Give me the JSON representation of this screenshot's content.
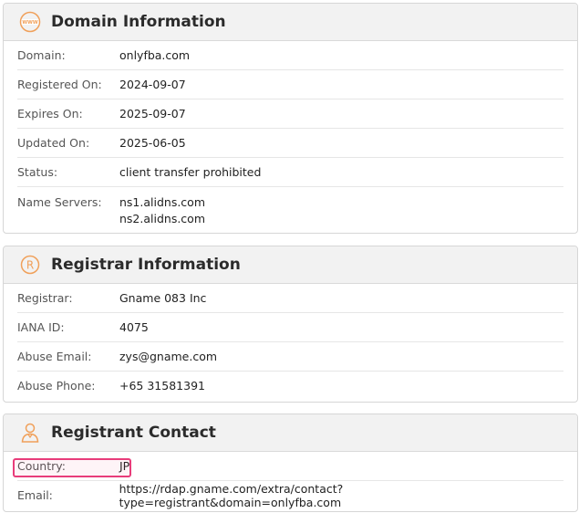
{
  "domain_info": {
    "title": "Domain Information",
    "icon": "www-icon",
    "rows": [
      {
        "label": "Domain:",
        "value": "onlyfba.com"
      },
      {
        "label": "Registered On:",
        "value": "2024-09-07"
      },
      {
        "label": "Expires On:",
        "value": "2025-09-07"
      },
      {
        "label": "Updated On:",
        "value": "2025-06-05"
      },
      {
        "label": "Status:",
        "value": "client transfer prohibited"
      }
    ],
    "name_servers_label": "Name Servers:",
    "name_servers": [
      "ns1.alidns.com",
      "ns2.alidns.com"
    ]
  },
  "registrar_info": {
    "title": "Registrar Information",
    "icon": "registered-icon",
    "rows": [
      {
        "label": "Registrar:",
        "value": "Gname 083 Inc"
      },
      {
        "label": "IANA ID:",
        "value": "4075"
      },
      {
        "label": "Abuse Email:",
        "value": "zys@gname.com"
      },
      {
        "label": "Abuse Phone:",
        "value": "+65 31581391"
      }
    ]
  },
  "registrant_contact": {
    "title": "Registrant Contact",
    "icon": "person-icon",
    "rows": [
      {
        "label": "Country:",
        "value": "JP"
      },
      {
        "label": "Email:",
        "value": "https://rdap.gname.com/extra/contact?type=registrant&domain=onlyfba.com"
      }
    ]
  },
  "colors": {
    "accent_icon": "#f0a05a",
    "highlight": "#e83c7a"
  }
}
